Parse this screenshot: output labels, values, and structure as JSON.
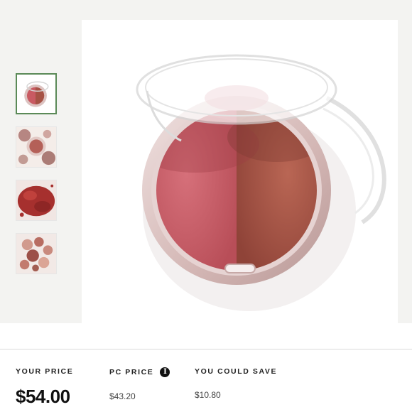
{
  "product": {
    "thumbnails": [
      {
        "icon": "blush-compact-thumbnail",
        "selected": true
      },
      {
        "icon": "blush-with-crushed-powder-thumbnail",
        "selected": false
      },
      {
        "icon": "red-powder-swatch-thumbnail",
        "selected": false
      },
      {
        "icon": "assorted-blush-pans-thumbnail",
        "selected": false
      }
    ],
    "main_image": "dual-tone blush compact with clear lid",
    "colors": {
      "blush_pink": "#c95a62",
      "blush_bronze": "#a65245",
      "compact_rim": "#d8bdbb",
      "thumb_active_border": "#5b8a58"
    }
  },
  "pricing": {
    "your_price_label": "YOUR PRICE",
    "your_price": "$54.00",
    "pc_price_label": "PC PRICE",
    "pc_price": "$43.20",
    "pc_info_icon": "i",
    "save_label": "YOU COULD SAVE",
    "save_amount": "$10.80"
  }
}
